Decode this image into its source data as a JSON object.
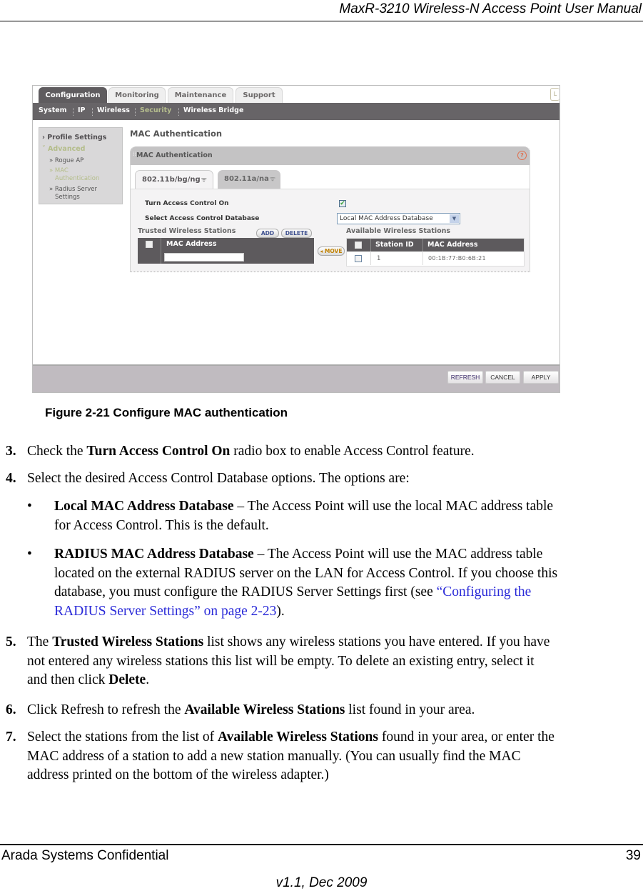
{
  "header": {
    "title": "MaxR-3210 Wireless-N Access Point User Manual"
  },
  "screenshot": {
    "main_tabs": [
      {
        "label": "Configuration",
        "active": true
      },
      {
        "label": "Monitoring",
        "active": false
      },
      {
        "label": "Maintenance",
        "active": false
      },
      {
        "label": "Support",
        "active": false
      }
    ],
    "logout_label": "L",
    "sub_nav": [
      {
        "label": "System",
        "active": false
      },
      {
        "label": "IP",
        "active": false
      },
      {
        "label": "Wireless",
        "active": false
      },
      {
        "label": "Security",
        "active": true
      },
      {
        "label": "Wireless Bridge",
        "active": false
      }
    ],
    "sidebar": {
      "profile_settings": "› Profile Settings",
      "advanced": "˅ Advanced",
      "rogue_ap": "» Rogue AP",
      "mac_auth_1": "» MAC",
      "mac_auth_2": "Authentication",
      "radius_1": "» Radius Server",
      "radius_2": "Settings"
    },
    "page_heading": "MAC Authentication",
    "panel": {
      "title": "MAC Authentication",
      "grip": "⁞⁞",
      "help_icon": "?",
      "radio_tabs": [
        {
          "label": "802.11b/bg/ng",
          "active": true
        },
        {
          "label": "802.11a/na",
          "active": false
        }
      ],
      "wifi_glyph": "ᯤ",
      "turn_access_control_label": "Turn Access Control On",
      "turn_access_control_checked": true,
      "check_glyph": "✔",
      "select_db_label": "Select Access Control Database",
      "select_db_value": "Local MAC Address Database",
      "select_arrow": "▼",
      "trusted": {
        "title": "Trusted Wireless Stations",
        "add_label": "ADD",
        "delete_label": "DELETE",
        "columns": [
          "",
          "MAC Address"
        ],
        "rows": [
          {
            "mac_input": ""
          }
        ]
      },
      "move_label": "◂ MOVE",
      "available": {
        "title": "Available Wireless Stations",
        "columns": [
          "",
          "Station ID",
          "MAC Address"
        ],
        "rows": [
          {
            "station_id": "1",
            "mac": "00:1B:77:B0:6B:21",
            "checked": false
          }
        ]
      }
    },
    "footer_buttons": {
      "refresh": "REFRESH",
      "cancel": "CANCEL",
      "apply": "APPLY"
    }
  },
  "caption": "Figure 2-21  Configure MAC authentication",
  "steps": {
    "s3": {
      "num": "3.",
      "pre": "Check the ",
      "bold": "Turn Access Control On",
      "post": " radio box to enable Access Control feature."
    },
    "s4": {
      "num": "4.",
      "text": "Select the desired Access Control Database options. The options are:"
    },
    "b1": {
      "bullet": "•",
      "bold": "Local MAC Address Database",
      "line1": " – The Access Point will use the local MAC address table",
      "line2": "for Access Control. This is the default."
    },
    "b2": {
      "bullet": "•",
      "bold": "RADIUS MAC Address Database",
      "line1": " – The Access Point will use the MAC address table",
      "line2": "located on the external RADIUS server on the LAN for Access Control. If you choose this",
      "line3_pre": "database, you must configure the RADIUS Server Settings first (see ",
      "link_a": "“Configuring the",
      "link_b": "RADIUS Server Settings” on page 2-23",
      "line4_post": ")."
    },
    "s5": {
      "num": "5.",
      "pre": "The ",
      "bold": "Trusted Wireless Stations",
      "line1": " list shows any wireless stations you have entered. If you have",
      "line2": "not entered any wireless stations this list will be empty. To delete an existing entry, select it",
      "line3_pre": "and then click ",
      "line3_bold": "Delete",
      "line3_post": "."
    },
    "s6": {
      "num": "6.",
      "pre": "Click Refresh to refresh the ",
      "bold": "Available Wireless Stations",
      "post": " list found in your area."
    },
    "s7": {
      "num": "7.",
      "pre": "Select the stations from the list of ",
      "bold": "Available Wireless Stations",
      "line1": " found in your area, or enter the",
      "line2": "MAC address of a station to add a new station manually. (You can usually find the MAC",
      "line3": "address printed on the bottom of the wireless adapter.)"
    }
  },
  "footer": {
    "left": "Arada Systems Confidential",
    "page": "39",
    "version": "v1.1, Dec 2009"
  }
}
